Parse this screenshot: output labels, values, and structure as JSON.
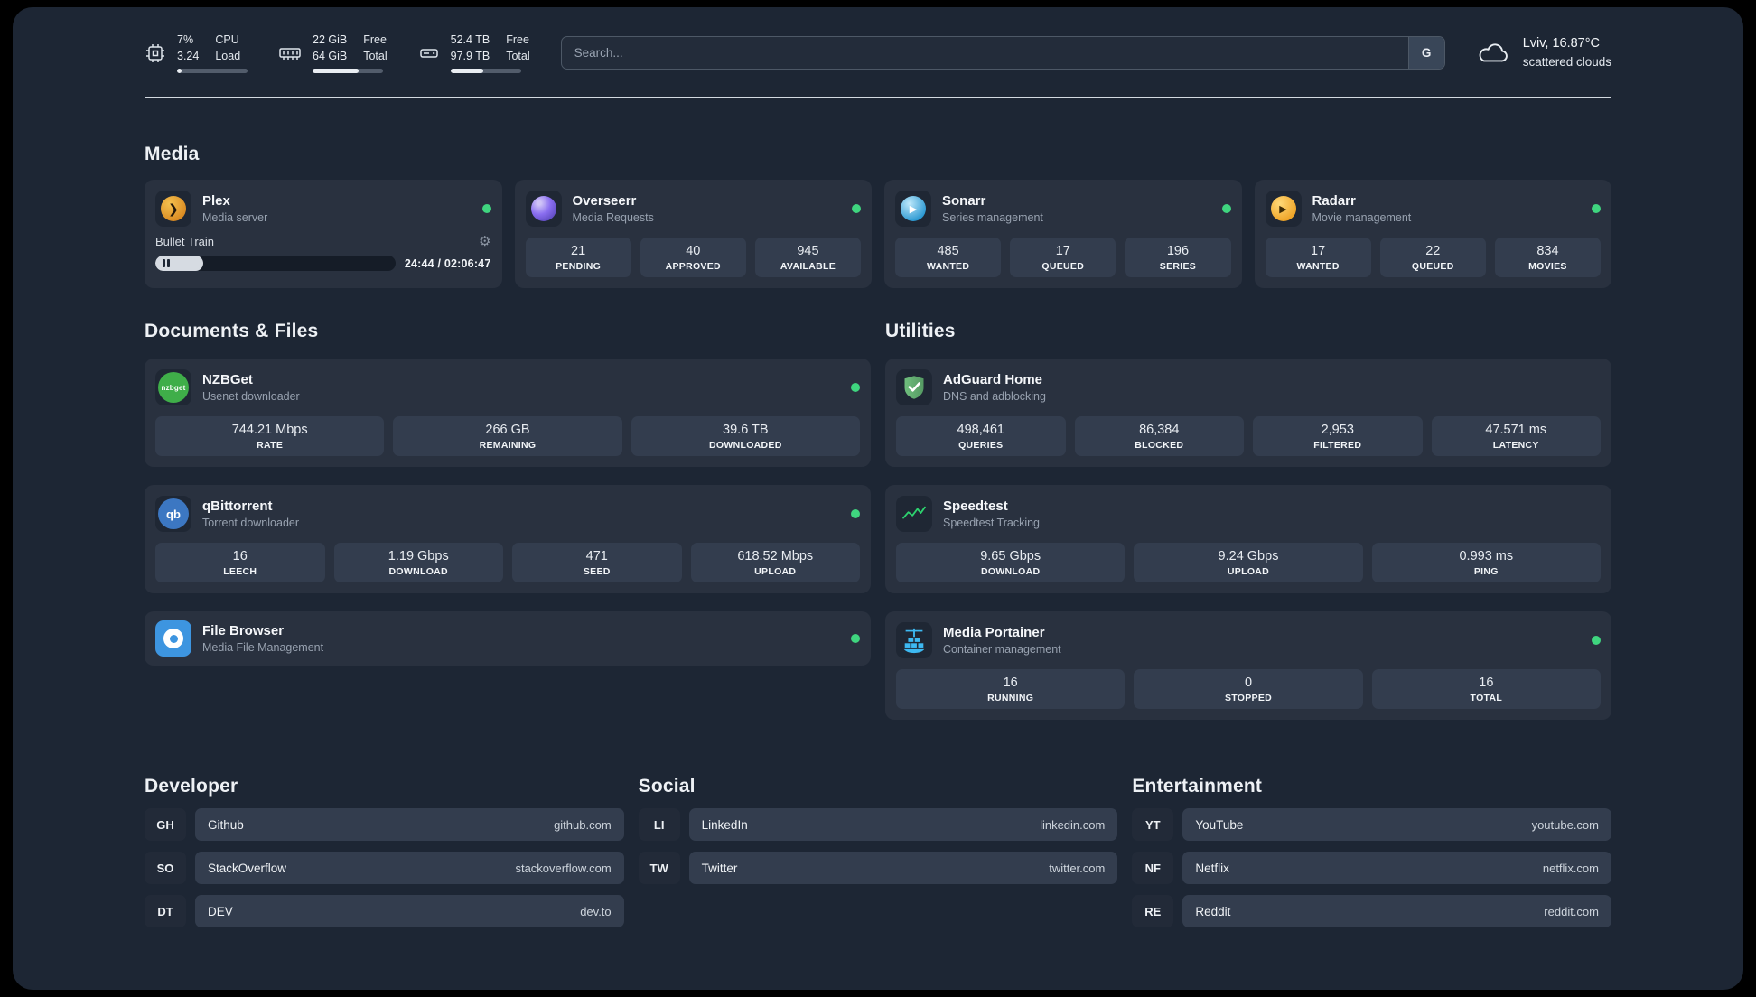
{
  "topbar": {
    "cpu": {
      "value_top": "7%",
      "value_bottom": "3.24",
      "label_top": "CPU",
      "label_bottom": "Load",
      "usage_pct": 7
    },
    "ram": {
      "value_top": "22 GiB",
      "value_bottom": "64 GiB",
      "label_top": "Free",
      "label_bottom": "Total",
      "usage_pct": 65
    },
    "disk": {
      "value_top": "52.4 TB",
      "value_bottom": "97.9 TB",
      "label_top": "Free",
      "label_bottom": "Total",
      "usage_pct": 47
    },
    "search": {
      "placeholder": "Search...",
      "engine_label": "G"
    },
    "weather": {
      "location": "Lviv, 16.87°C",
      "condition": "scattered clouds"
    }
  },
  "sections": {
    "media": {
      "title": "Media",
      "apps": [
        {
          "name": "Plex",
          "desc": "Media server",
          "online": true,
          "player": {
            "track": "Bullet Train",
            "time": "24:44 / 02:06:47",
            "progress_pct": 20
          }
        },
        {
          "name": "Overseerr",
          "desc": "Media Requests",
          "online": true,
          "stats": [
            {
              "value": "21",
              "label": "PENDING"
            },
            {
              "value": "40",
              "label": "APPROVED"
            },
            {
              "value": "945",
              "label": "AVAILABLE"
            }
          ]
        },
        {
          "name": "Sonarr",
          "desc": "Series management",
          "online": true,
          "stats": [
            {
              "value": "485",
              "label": "WANTED"
            },
            {
              "value": "17",
              "label": "QUEUED"
            },
            {
              "value": "196",
              "label": "SERIES"
            }
          ]
        },
        {
          "name": "Radarr",
          "desc": "Movie management",
          "online": true,
          "stats": [
            {
              "value": "17",
              "label": "WANTED"
            },
            {
              "value": "22",
              "label": "QUEUED"
            },
            {
              "value": "834",
              "label": "MOVIES"
            }
          ]
        }
      ]
    },
    "documents": {
      "title": "Documents & Files",
      "apps": [
        {
          "name": "NZBGet",
          "desc": "Usenet downloader",
          "online": true,
          "icon_text": "nzbget",
          "stats": [
            {
              "value": "744.21 Mbps",
              "label": "RATE"
            },
            {
              "value": "266 GB",
              "label": "REMAINING"
            },
            {
              "value": "39.6 TB",
              "label": "DOWNLOADED"
            }
          ]
        },
        {
          "name": "qBittorrent",
          "desc": "Torrent downloader",
          "online": true,
          "icon_text": "qb",
          "stats": [
            {
              "value": "16",
              "label": "LEECH"
            },
            {
              "value": "1.19 Gbps",
              "label": "DOWNLOAD"
            },
            {
              "value": "471",
              "label": "SEED"
            },
            {
              "value": "618.52 Mbps",
              "label": "UPLOAD"
            }
          ]
        },
        {
          "name": "File Browser",
          "desc": "Media File Management",
          "online": true
        }
      ]
    },
    "utilities": {
      "title": "Utilities",
      "apps": [
        {
          "name": "AdGuard Home",
          "desc": "DNS and adblocking",
          "stats": [
            {
              "value": "498,461",
              "label": "QUERIES"
            },
            {
              "value": "86,384",
              "label": "BLOCKED"
            },
            {
              "value": "2,953",
              "label": "FILTERED"
            },
            {
              "value": "47.571 ms",
              "label": "LATENCY"
            }
          ]
        },
        {
          "name": "Speedtest",
          "desc": "Speedtest Tracking",
          "stats": [
            {
              "value": "9.65 Gbps",
              "label": "DOWNLOAD"
            },
            {
              "value": "9.24 Gbps",
              "label": "UPLOAD"
            },
            {
              "value": "0.993 ms",
              "label": "PING"
            }
          ]
        },
        {
          "name": "Media Portainer",
          "desc": "Container management",
          "online": true,
          "stats": [
            {
              "value": "16",
              "label": "RUNNING"
            },
            {
              "value": "0",
              "label": "STOPPED"
            },
            {
              "value": "16",
              "label": "TOTAL"
            }
          ]
        }
      ]
    }
  },
  "bookmarks": {
    "developer": {
      "title": "Developer",
      "items": [
        {
          "abbr": "GH",
          "name": "Github",
          "url": "github.com"
        },
        {
          "abbr": "SO",
          "name": "StackOverflow",
          "url": "stackoverflow.com"
        },
        {
          "abbr": "DT",
          "name": "DEV",
          "url": "dev.to"
        }
      ]
    },
    "social": {
      "title": "Social",
      "items": [
        {
          "abbr": "LI",
          "name": "LinkedIn",
          "url": "linkedin.com"
        },
        {
          "abbr": "TW",
          "name": "Twitter",
          "url": "twitter.com"
        }
      ]
    },
    "entertainment": {
      "title": "Entertainment",
      "items": [
        {
          "abbr": "YT",
          "name": "YouTube",
          "url": "youtube.com"
        },
        {
          "abbr": "NF",
          "name": "Netflix",
          "url": "netflix.com"
        },
        {
          "abbr": "RE",
          "name": "Reddit",
          "url": "reddit.com"
        }
      ]
    }
  },
  "colors": {
    "background": "#1d2634",
    "card": "#29313f",
    "tile": "#333d4e",
    "status_online": "#3fd57f",
    "plex": "#e5a00d",
    "overseerr": "#8a6ef0",
    "sonarr": "#35c5f4",
    "radarr": "#f0a62a",
    "nzbget": "#3fae49",
    "qbittorrent": "#3c77c2",
    "filebrowser": "#3d95e0",
    "adguard": "#66b574",
    "speedtest": "#2dd36f",
    "portainer": "#3db9f2"
  }
}
